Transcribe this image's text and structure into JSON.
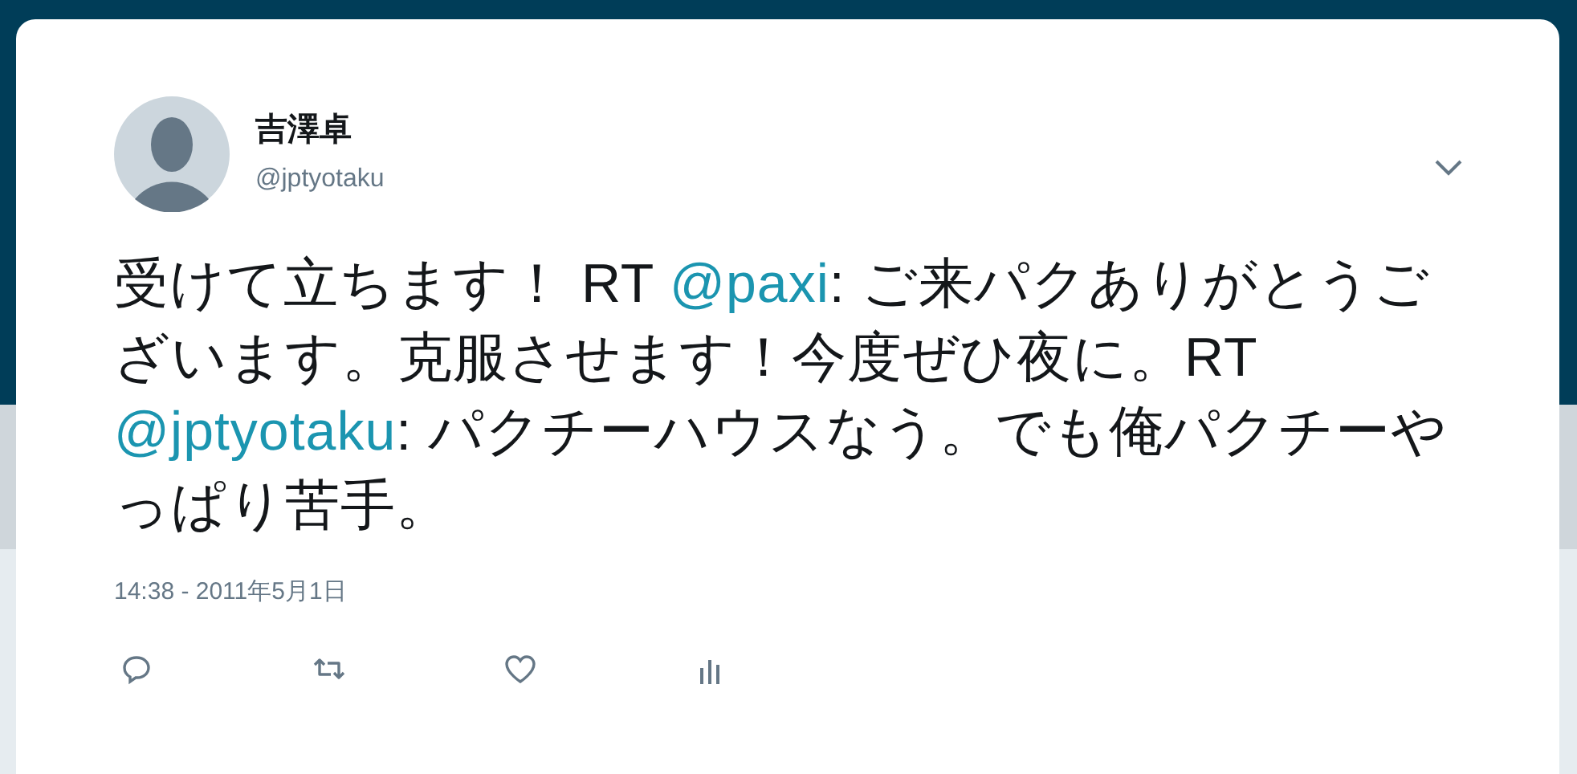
{
  "author": {
    "name": "吉澤卓",
    "handle": "@jptyotaku"
  },
  "tweet": {
    "segments": [
      {
        "kind": "text",
        "text": "受けて立ちます！ RT "
      },
      {
        "kind": "mention",
        "text": "@paxi"
      },
      {
        "kind": "text",
        "text": ": ご来パクありがとうございます。克服させます！今度ぜひ夜に。RT "
      },
      {
        "kind": "mention",
        "text": "@jptyotaku"
      },
      {
        "kind": "text",
        "text": ": パクチーハウスなう。でも俺パクチーやっぱり苦手。"
      }
    ]
  },
  "timestamp": "14:38 - 2011年5月1日",
  "actions": [
    {
      "kind": "reply"
    },
    {
      "kind": "retweet"
    },
    {
      "kind": "like"
    },
    {
      "kind": "analytics"
    }
  ]
}
